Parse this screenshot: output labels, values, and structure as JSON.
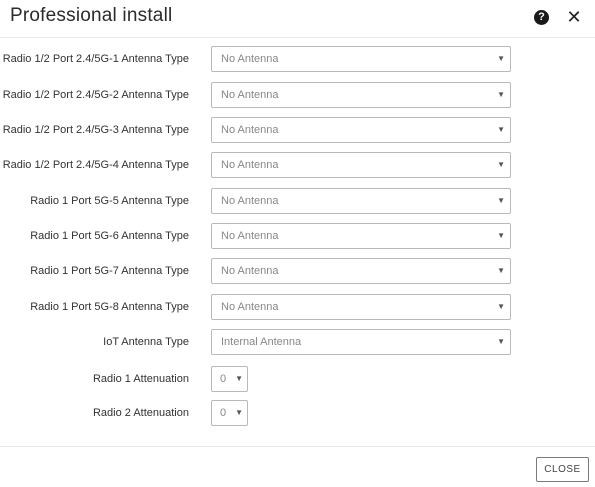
{
  "dialog": {
    "title": "Professional install",
    "help_icon_glyph": "?",
    "close_icon_glyph": "✕"
  },
  "fields": [
    {
      "label": "Radio 1/2 Port 2.4/5G-1 Antenna Type",
      "value": "No Antenna"
    },
    {
      "label": "Radio 1/2 Port 2.4/5G-2 Antenna Type",
      "value": "No Antenna"
    },
    {
      "label": "Radio 1/2 Port 2.4/5G-3 Antenna Type",
      "value": "No Antenna"
    },
    {
      "label": "Radio 1/2 Port 2.4/5G-4 Antenna Type",
      "value": "No Antenna"
    },
    {
      "label": "Radio 1 Port 5G-5 Antenna Type",
      "value": "No Antenna"
    },
    {
      "label": "Radio 1 Port 5G-6 Antenna Type",
      "value": "No Antenna"
    },
    {
      "label": "Radio 1 Port 5G-7 Antenna Type",
      "value": "No Antenna"
    },
    {
      "label": "Radio 1 Port 5G-8 Antenna Type",
      "value": "No Antenna"
    },
    {
      "label": "IoT Antenna Type",
      "value": "Internal Antenna"
    },
    {
      "label": "Radio 1 Attenuation",
      "value": "0"
    },
    {
      "label": "Radio 2 Attenuation",
      "value": "0"
    }
  ],
  "caret_glyph": "▼",
  "footer": {
    "close_label": "CLOSE"
  }
}
